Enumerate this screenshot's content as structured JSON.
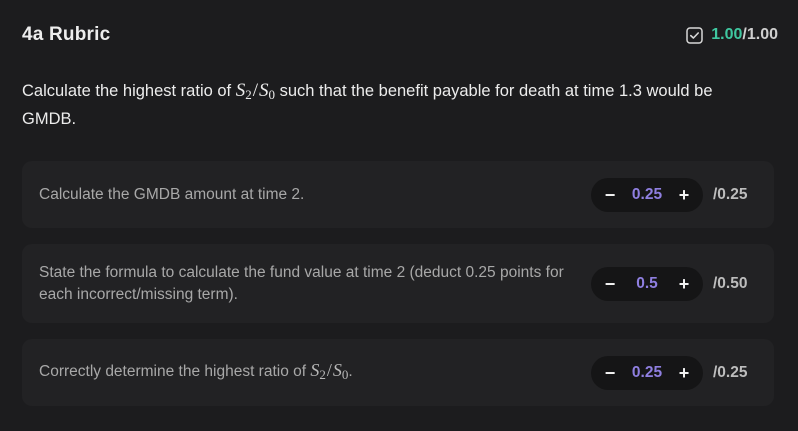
{
  "rubric": {
    "title": "4a Rubric",
    "score_earned": "1.00",
    "score_total": "/1.00",
    "check_icon": "check-square-icon",
    "accent_color": "#3fc7a0",
    "value_color": "#8f7fe0"
  },
  "question": {
    "text_before": "Calculate the highest ratio of ",
    "math_s": "S",
    "math_sub_2": "2",
    "math_slash": "/",
    "math_sub_0": "0",
    "text_after": " such that the benefit payable for death at time 1.3 would be GMDB."
  },
  "items": [
    {
      "text": "Calculate the GMDB amount at time 2.",
      "value": "0.25",
      "max": "/0.25",
      "minus": "−",
      "plus": "+"
    },
    {
      "text": "State the formula to calculate the fund value at time 2 (deduct 0.25 points for each incorrect/missing term).",
      "value": "0.5",
      "max": "/0.50",
      "minus": "−",
      "plus": "+"
    },
    {
      "text_before": "Correctly determine the highest ratio of ",
      "text_after": ".",
      "value": "0.25",
      "max": "/0.25",
      "minus": "−",
      "plus": "+"
    }
  ]
}
